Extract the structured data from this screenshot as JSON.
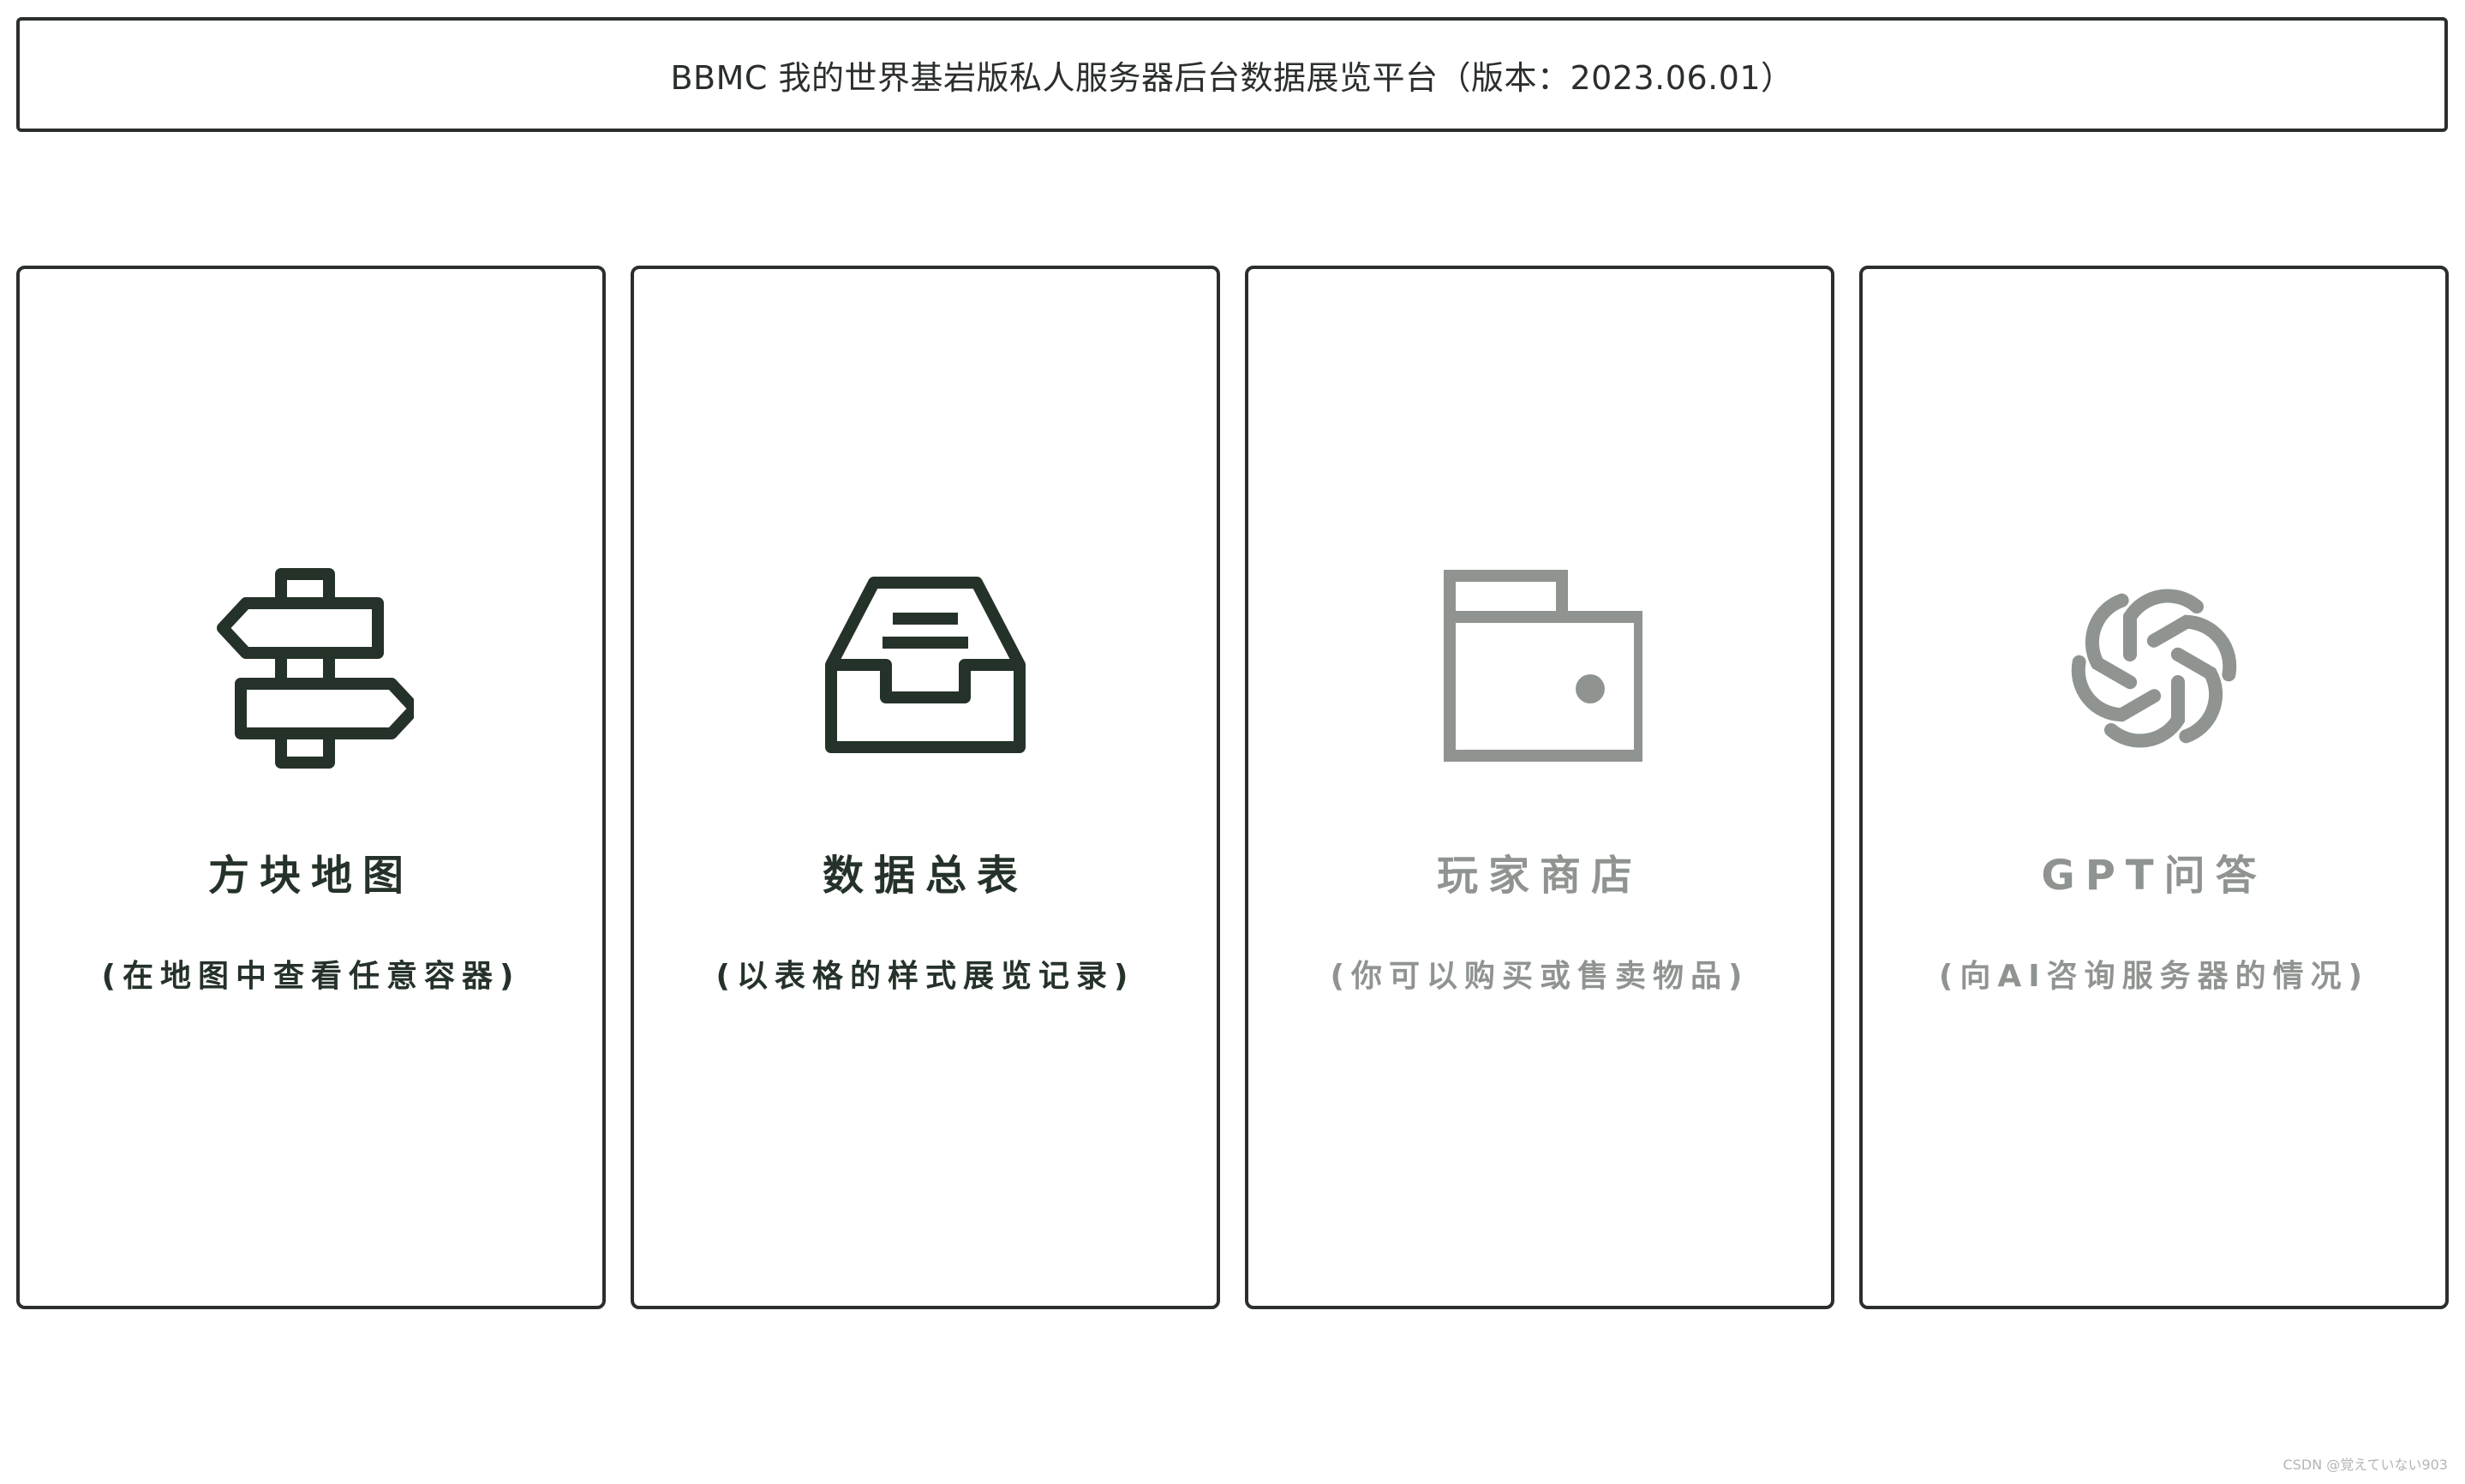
{
  "header": {
    "title": "BBMC 我的世界基岩版私人服务器后台数据展览平台（版本：2023.06.01）"
  },
  "colors": {
    "active": "#253229",
    "inactive": "#8f9490",
    "border": "#2b2f2c"
  },
  "cards": [
    {
      "title": "方块地图",
      "subtitle": "(在地图中查看任意容器)",
      "icon": "signpost-icon",
      "state": "active"
    },
    {
      "title": "数据总表",
      "subtitle": "(以表格的样式展览记录)",
      "icon": "archive-tray-icon",
      "state": "active"
    },
    {
      "title": "玩家商店",
      "subtitle": "(你可以购买或售卖物品)",
      "icon": "wallet-icon",
      "state": "inactive"
    },
    {
      "title": "GPT问答",
      "subtitle": "(向AI咨询服务器的情况)",
      "icon": "openai-logo-icon",
      "state": "inactive"
    }
  ],
  "watermark": "CSDN @覚えていない903"
}
